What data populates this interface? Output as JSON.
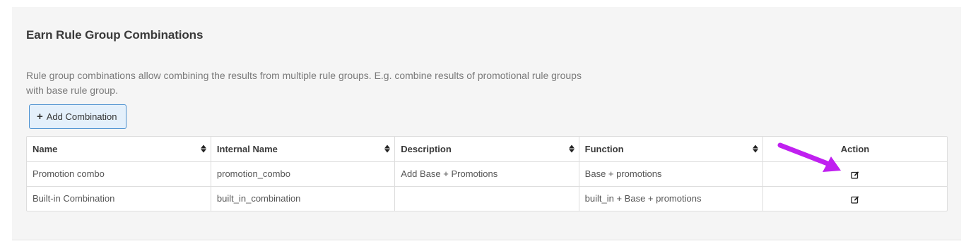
{
  "section": {
    "title": "Earn Rule Group Combinations",
    "description": "Rule group combinations allow combining the results from multiple rule groups. E.g. combine results of promotional rule groups with base rule group.",
    "add_button_label": "Add Combination"
  },
  "table": {
    "columns": [
      {
        "label": "Name",
        "sortable": true
      },
      {
        "label": "Internal Name",
        "sortable": true
      },
      {
        "label": "Description",
        "sortable": true
      },
      {
        "label": "Function",
        "sortable": true
      },
      {
        "label": "Action",
        "sortable": false
      }
    ],
    "rows": [
      {
        "name": "Promotion combo",
        "internal_name": "promotion_combo",
        "description": "Add Base + Promotions",
        "function": "Base + promotions",
        "action_icon": "edit-icon"
      },
      {
        "name": "Built-in Combination",
        "internal_name": "built_in_combination",
        "description": "",
        "function": "built_in + Base + promotions",
        "action_icon": "edit-icon"
      }
    ]
  },
  "annotation": {
    "arrow_color": "#c020f0"
  },
  "colors": {
    "panel_bg": "#f5f5f5",
    "button_bg": "#e4f0fb",
    "button_border": "#4a90d0"
  }
}
